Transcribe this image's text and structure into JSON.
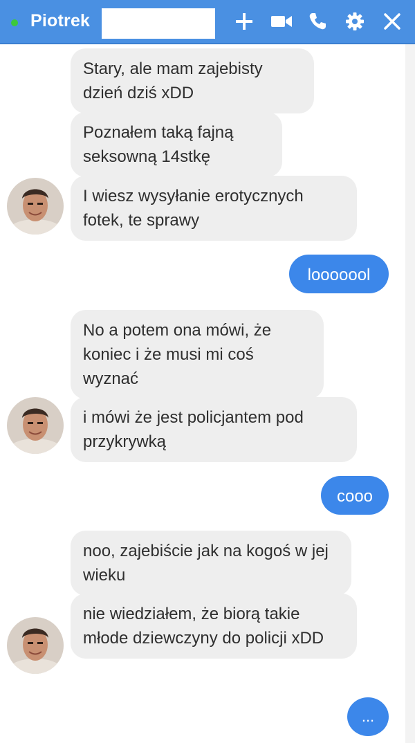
{
  "header": {
    "contact_name": "Piotrek",
    "status_color": "#3cc93c",
    "bar_color": "#4a90e2",
    "icons": [
      "plus-icon",
      "video-camera-icon",
      "phone-icon",
      "gear-icon",
      "close-icon"
    ]
  },
  "messages": [
    {
      "direction": "in",
      "text": "Stary, ale mam zajebisty dzień dziś xDD"
    },
    {
      "direction": "in",
      "text": "Poznałem taką fajną seksowną 14stkę"
    },
    {
      "direction": "in",
      "text": "I wiesz wysyłanie erotycznych fotek, te sprawy"
    },
    {
      "direction": "out",
      "text": "looooool"
    },
    {
      "direction": "in",
      "text": "No a potem ona mówi, że koniec i że musi mi coś wyznać"
    },
    {
      "direction": "in",
      "text": "i mówi że jest policjantem pod przykrywką"
    },
    {
      "direction": "out",
      "text": "cooo"
    },
    {
      "direction": "in",
      "text": "noo, zajebiście jak na kogoś w jej wieku"
    },
    {
      "direction": "in",
      "text": "nie wiedziałem, że biorą takie młode dziewczyny do policji xDD"
    }
  ],
  "typing_indicator": "...",
  "colors": {
    "incoming_bubble": "#eeeeee",
    "outgoing_bubble": "#3c87ea"
  }
}
